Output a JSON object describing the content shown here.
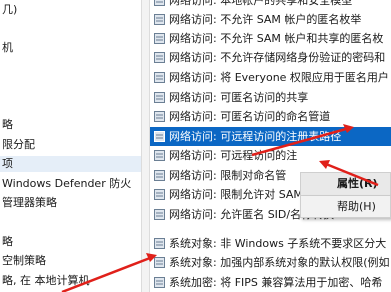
{
  "tree": {
    "items": [
      {
        "label": "几)"
      },
      {
        "label": "机"
      },
      {
        "label": "略"
      },
      {
        "label": "限分配"
      },
      {
        "label": "项"
      },
      {
        "label": "Windows Defender 防火"
      },
      {
        "label": "管理器策略"
      },
      {
        "label": "略"
      },
      {
        "label": "空制策略"
      },
      {
        "label": "略, 在 本地计算机"
      }
    ]
  },
  "policies": {
    "rows": [
      {
        "text": "网络访问: 本地帐户的共享和安全模型"
      },
      {
        "text": "网络访问: 不允许 SAM 帐户的匿名枚举"
      },
      {
        "text": "网络访问: 不允许 SAM 帐户和共享的匿名枚"
      },
      {
        "text": "网络访问: 不允许存储网络身份验证的密码和"
      },
      {
        "text": "网络访问: 将 Everyone 权限应用于匿名用户"
      },
      {
        "text": "网络访问: 可匿名访问的共享"
      },
      {
        "text": "网络访问: 可匿名访问的命名管道"
      },
      {
        "text": "网络访问: 可远程访问的注册表路径"
      },
      {
        "text": "网络访问: 可远程访问的注"
      },
      {
        "text": "网络访问: 限制对命名管"
      },
      {
        "text": "网络访问: 限制允许对 SAM 进行远程调用的客户端"
      },
      {
        "text": "网络访问: 允许匿名 SID/名称转换"
      },
      {
        "text": "系统对象: 非 Windows 子系统不要求区分大"
      },
      {
        "text": "系统对象: 加强内部系统对象的默认权限(例如"
      },
      {
        "text": "系统加密: 将 FIPS 兼容算法用于加密、哈希"
      }
    ]
  },
  "context_menu": {
    "properties": "属性(R)",
    "help": "帮助(H)"
  },
  "colors": {
    "selection": "#0b67c4",
    "arrow": "#e0201a"
  }
}
